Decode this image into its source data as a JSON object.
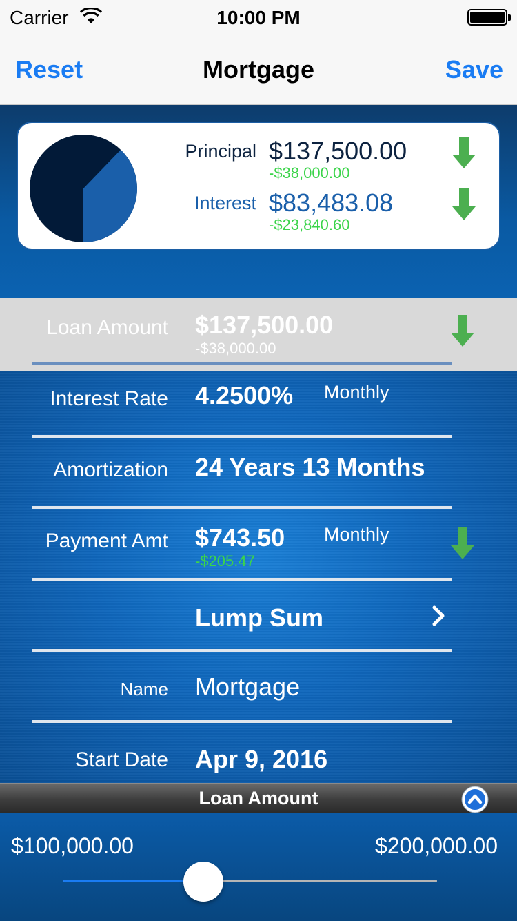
{
  "status_bar": {
    "carrier": "Carrier",
    "time": "10:00 PM"
  },
  "nav": {
    "reset_label": "Reset",
    "title": "Mortgage",
    "save_label": "Save"
  },
  "summary": {
    "principal": {
      "label": "Principal",
      "value": "$137,500.00",
      "delta": "-$38,000.00",
      "trend": "down"
    },
    "interest": {
      "label": "Interest",
      "value": "$83,483.08",
      "delta": "-$23,840.60",
      "trend": "down"
    },
    "pie_colors": {
      "principal": "#021a38",
      "interest": "#1a5faa"
    }
  },
  "rows": {
    "loan_amount": {
      "label": "Loan Amount",
      "value": "$137,500.00",
      "delta": "-$38,000.00",
      "trend": "down"
    },
    "interest_rate": {
      "label": "Interest Rate",
      "value": "4.2500%",
      "frequency": "Monthly"
    },
    "amortization": {
      "label": "Amortization",
      "value": "24 Years 13 Months"
    },
    "payment_amt": {
      "label": "Payment Amt",
      "value": "$743.50",
      "frequency": "Monthly",
      "delta": "-$205.47",
      "trend": "down"
    },
    "lump_sum": {
      "label": "Lump Sum"
    },
    "name": {
      "label": "Name",
      "value": "Mortgage"
    },
    "start_date": {
      "label": "Start Date",
      "value": "Apr 9, 2016"
    }
  },
  "slider_panel": {
    "title": "Loan Amount",
    "min_label": "$100,000.00",
    "max_label": "$200,000.00",
    "fraction": 0.375
  },
  "colors": {
    "accent": "#1a7cf3",
    "delta_green": "#3bd44a",
    "arrow_green": "#4caf50"
  }
}
